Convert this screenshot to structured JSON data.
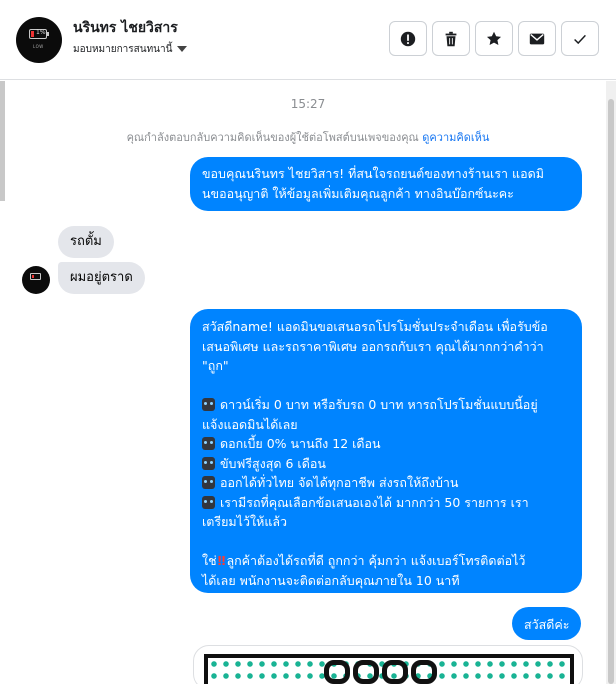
{
  "header": {
    "name": "นรินทร ไชยวิสาร",
    "assign_label": "มอบหมายการสนทนานี้",
    "actions": {
      "spam": "spam-icon",
      "delete": "trash-icon",
      "star": "star-icon",
      "unread": "envelope-icon",
      "done": "check-icon"
    }
  },
  "chat": {
    "time": "15:27",
    "notice_text": "คุณกำลังตอบกลับความคิดเห็นของผู้ใช้ต่อโพสต์บนเพจของคุณ",
    "notice_link": "ดูความคิดเห็น",
    "messages": [
      {
        "from": "page",
        "lines": [
          "ขอบคุณนรินทร ไชยวิสาร! ที่สนใจรถยนต์ของทางร้านเรา แอดมิ",
          "นขออนุญาติ ให้ข้อมูลเพิ่มเติมคุณลูกค้า ทางอินบ๊อกซ์นะคะ"
        ]
      },
      {
        "from": "user",
        "text": "รถตั้ม"
      },
      {
        "from": "user",
        "text": "ผมอยู่ตราด"
      },
      {
        "from": "page",
        "intro": [
          "สวัสดีname! แอดมินขอเสนอรถโปรโมชั่นประจำเดือน เพื่อรับข้อ",
          "เสนอพิเศษ และรถราคาพิเศษ ออกรถกับเรา คุณได้มากกว่าคำว่า",
          "\"ถูก\""
        ],
        "bullets": [
          [
            "ดาวน์เริ่ม 0 บาท หรือรับรถ 0 บาท หารถโปรโมชั่นแบบนี้อยู่",
            "แจ้งแอดมินได้เลย"
          ],
          [
            "ดอกเบี้ย 0% นานถึง 12 เดือน"
          ],
          [
            "ขับฟรีสูงสุด 6 เดือน"
          ],
          [
            "ออกได้ทั่วไทย จัดได้ทุกอาชีพ ส่งรถให้ถึงบ้าน"
          ],
          [
            "เรามีรถที่คุณเลือกข้อเสนอเองได้ มากกว่า 50 รายการ เรา",
            "เตรียมไว้ให้แล้ว"
          ]
        ],
        "closing_prefix": "ใช่",
        "closing": [
          "ลูกค้าต้องได้รถที่ดี ถูกกว่า คุ้มกว่า แจ้งเบอร์โทรติดต่อไว้",
          "ได้เลย พนักงานจะติดต่อกลับคุณภายใน 10 นาที"
        ]
      },
      {
        "from": "page",
        "text": "สวัสดีค่ะ"
      }
    ]
  },
  "colors": {
    "outgoing_bubble": "#0084ff",
    "incoming_bubble": "#e4e6eb",
    "link": "#1877f2"
  }
}
